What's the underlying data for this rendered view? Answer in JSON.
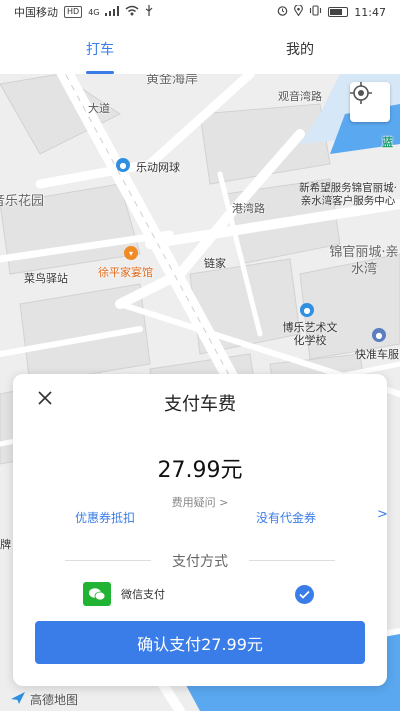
{
  "status_bar": {
    "carrier": "中国移动",
    "carrier_badge": "HD",
    "network": "4G",
    "time": "11:47"
  },
  "tabs": [
    {
      "label": "打车",
      "active": true
    },
    {
      "label": "我的",
      "active": false
    }
  ],
  "map": {
    "labels": {
      "huangjin": "黄金海岸",
      "guanhai": "观音湾路",
      "lan": "蓝",
      "avenue": "大道",
      "garden": "音乐花园",
      "tennis": "乐动网球",
      "xinxiwang": "新希望服务锦官丽城·亲水湾客户服务中心",
      "gangwan": "港湾路",
      "restaurant": "徐平家宴馆",
      "lianjia": "链家",
      "jinguan": "锦官丽城·亲水湾",
      "cainiao": "菜鸟驿站",
      "school": "博乐艺术文化学校",
      "kuaizhun": "快准车服",
      "pai": "牌"
    },
    "provider": "高德地图"
  },
  "payment": {
    "title": "支付车费",
    "amount": "27.99元",
    "fee_query": "费用疑问 >",
    "coupon_label": "优惠券抵扣",
    "voucher_label": "没有代金券",
    "voucher_arrow": ">",
    "method_title": "支付方式",
    "method_name": "微信支付",
    "method_selected": true,
    "confirm_label": "确认支付27.99元"
  },
  "colors": {
    "accent": "#3b7de8",
    "wechat": "#21b333",
    "water": "#5aa8f0",
    "road": "#ffffff"
  }
}
